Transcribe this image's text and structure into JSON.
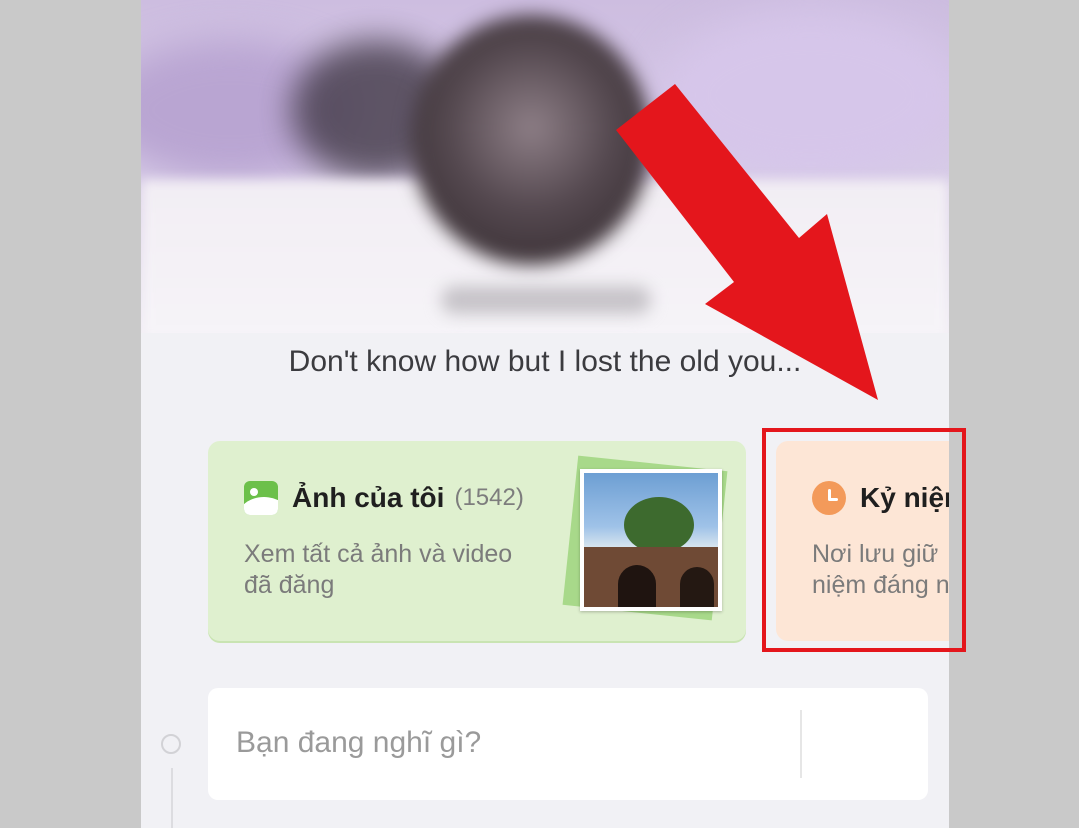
{
  "profile": {
    "bio": "Don't know how but I lost the old you..."
  },
  "cards": {
    "photos": {
      "title": "Ảnh của tôi",
      "count": "(1542)",
      "desc_line1": "Xem tất cả ảnh và video",
      "desc_line2": "đã đăng",
      "icon": "image-icon"
    },
    "memories": {
      "title": "Kỷ niệm",
      "desc_line1": "Nơi lưu giữ",
      "desc_line2": "niệm đáng n",
      "icon": "clock-icon"
    }
  },
  "composer": {
    "placeholder": "Bạn đang nghĩ gì?",
    "photo_icon": "image-icon"
  },
  "annotation": {
    "arrow_color": "#e4161c",
    "box_color": "#e4161c"
  },
  "colors": {
    "photos_card_bg": "#dff0cf",
    "memories_card_bg": "#fde6d6",
    "accent_green": "#6cc04a",
    "accent_orange": "#f39a5a"
  }
}
